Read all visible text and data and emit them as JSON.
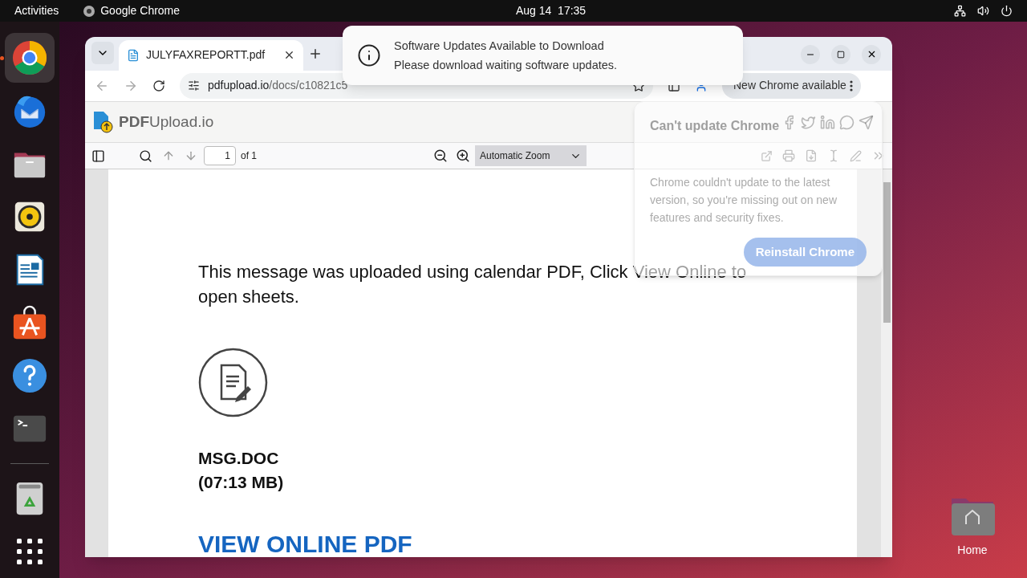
{
  "top_bar": {
    "activities": "Activities",
    "app_name": "Google Chrome",
    "clock": "Aug 14  17:35"
  },
  "dock": [
    {
      "kind": "chrome",
      "running": true
    },
    {
      "kind": "thunderbird",
      "running": false
    },
    {
      "kind": "files",
      "running": false
    },
    {
      "kind": "rhythmbox",
      "running": false
    },
    {
      "kind": "writer",
      "running": false
    },
    {
      "kind": "app-center",
      "running": false
    },
    {
      "kind": "help",
      "running": false
    },
    {
      "kind": "terminal",
      "running": false
    },
    {
      "kind": "separator"
    },
    {
      "kind": "trash",
      "running": false
    },
    {
      "kind": "apps-grid",
      "running": false
    }
  ],
  "browser": {
    "tabs": [
      {
        "title": "JULYFAXREPORTT.pdf",
        "selected": true
      }
    ],
    "url_host": "pdfupload.io",
    "url_path": "/docs/c10821c5",
    "update_button": "New Chrome available"
  },
  "site_header": {
    "logo": "**PDF**Upload.io"
  },
  "pdf_toolbar": {
    "page_input": "1",
    "page_count": "of 1",
    "zoom": "Automatic Zoom"
  },
  "document": {
    "message": "This message was uploaded using calendar PDF, Click View Online to open sheets.",
    "file_name": "MSG.DOC",
    "file_size": "(07:13 MB)",
    "link": "VIEW ONLINE PDF"
  },
  "notification": {
    "title": "Software Updates Available to Download",
    "body": "Please download waiting software updates."
  },
  "update_popup": {
    "title": "Can't update Chrome",
    "body": "Chrome couldn't update to the latest version, so you're missing out on new features and security fixes.",
    "button": "Reinstall Chrome"
  },
  "desktop_icons": [
    {
      "label": "Home"
    }
  ]
}
